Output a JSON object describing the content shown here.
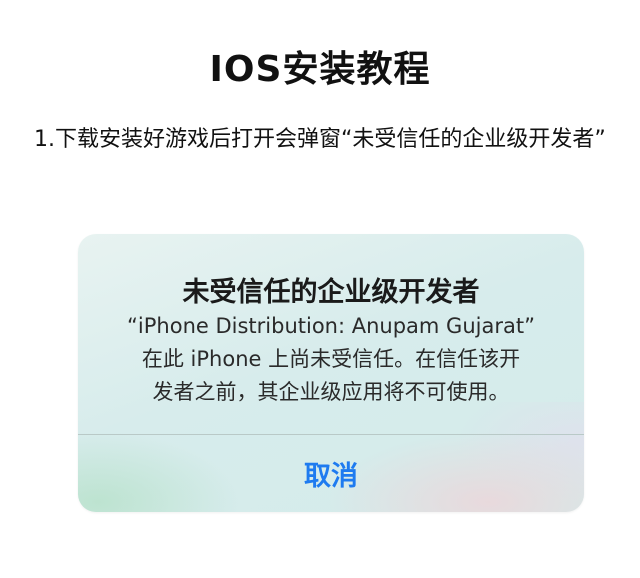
{
  "page": {
    "title": "IOS安装教程",
    "instruction": "1.下载安装好游戏后打开会弹窗“未受信任的企业级开发者”"
  },
  "alert": {
    "title": "未受信任的企业级开发者",
    "message_line1": "“iPhone Distribution: Anupam Gujarat”",
    "message_line2": "在此 iPhone 上尚未受信任。在信任该开",
    "message_line3": "发者之前，其企业级应用将不可使用。",
    "cancel_label": "取消"
  },
  "colors": {
    "button_text": "#1e7bf0",
    "alert_background": "#d7ecec"
  }
}
